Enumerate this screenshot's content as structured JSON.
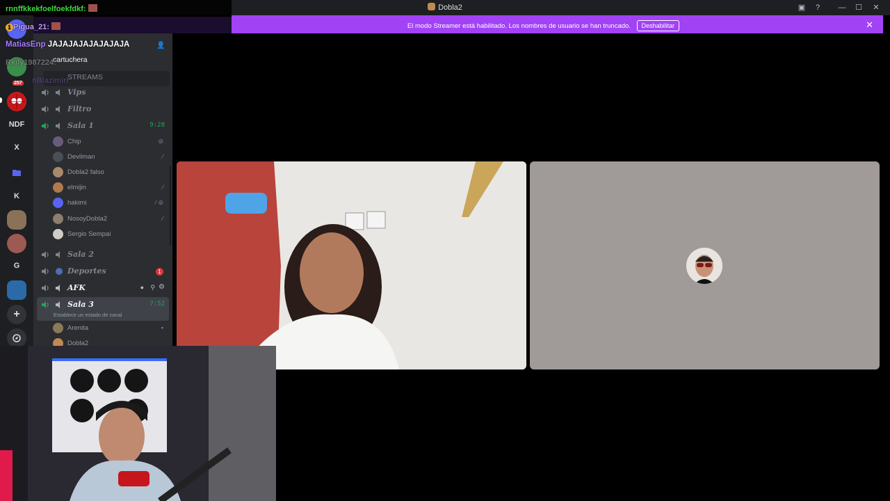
{
  "window": {
    "title": "Dobla2",
    "buttons": [
      "minimize",
      "maximize",
      "close"
    ]
  },
  "banner": {
    "message": "El modo Streamer está habilitado. Los nombres de usuario se han truncado.",
    "button_label": "Deshabilitar",
    "color": "#a242f5"
  },
  "chat_overlay": [
    {
      "user": "rnnffkkekfoelfoekfdkf:",
      "color": "#3ddc3d"
    },
    {
      "user": "Pigua_21:",
      "color": "#c79bff"
    },
    {
      "user": "MatiasEnp",
      "message": "JAJAJAJAJAJAJAJA",
      "color": "#a77bff"
    },
    {
      "user": "Rkily1987224:",
      "color": "#8e8e8e"
    },
    {
      "user": "nBlazimiri",
      "color": "#6e4fa8"
    }
  ],
  "servers": {
    "badge_count": "257",
    "items": [
      "NDF",
      "X",
      "K",
      "G"
    ]
  },
  "sidebar": {
    "header_channel": "cartuchera",
    "streams_category": "STREAMS",
    "channels": [
      {
        "name": "Vips"
      },
      {
        "name": "Filtro"
      },
      {
        "name": "Sala 1",
        "time": "9:28"
      },
      {
        "name": "Sala 2"
      },
      {
        "name": "Deportes",
        "badge": "1"
      },
      {
        "name": "AFK"
      },
      {
        "name": "Sala 3",
        "time": "7:52",
        "status": "Establece un estado de canal"
      }
    ],
    "sala1_members": [
      {
        "name": "Chip"
      },
      {
        "name": "Devilman"
      },
      {
        "name": "Dobla2 falso"
      },
      {
        "name": "elmijin"
      },
      {
        "name": "hakimi"
      },
      {
        "name": "NosoyDobla2"
      },
      {
        "name": "Sergio Sempai"
      }
    ],
    "sala3_members": [
      {
        "name": "Arenita"
      },
      {
        "name": "Dobla2"
      }
    ]
  }
}
